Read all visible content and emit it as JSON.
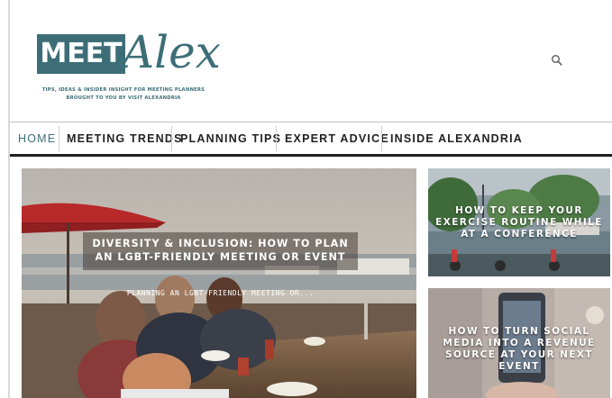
{
  "brand": {
    "logo_word1": "MEET",
    "logo_word2": "Alex",
    "tagline_line1": "TIPS, IDEAS & INSIDER INSIGHT FOR MEETING PLANNERS",
    "tagline_line2": "BROUGHT TO YOU BY VISIT ALEXANDRIA",
    "accent_color": "#3d6e78"
  },
  "header": {
    "search_icon": "search-icon"
  },
  "nav": {
    "items": [
      {
        "label": "HOME",
        "active": true
      },
      {
        "label": "MEETING TRENDS",
        "active": false
      },
      {
        "label": "PLANNING TIPS",
        "active": false
      },
      {
        "label": "EXPERT ADVICE",
        "active": false
      },
      {
        "label": "INSIDE ALEXANDRIA",
        "active": false
      }
    ]
  },
  "featured": {
    "title": "DIVERSITY & INCLUSION: HOW TO PLAN AN LGBT-FRIENDLY MEETING OR EVENT",
    "excerpt": "PLANNING AN LGBT-FRIENDLY MEETING OR..."
  },
  "side_posts": [
    {
      "title": "HOW TO KEEP YOUR EXERCISE ROUTINE WHILE AT A CONFERENCE"
    },
    {
      "title": "HOW TO TURN SOCIAL MEDIA INTO A REVENUE SOURCE AT YOUR NEXT EVENT"
    }
  ]
}
